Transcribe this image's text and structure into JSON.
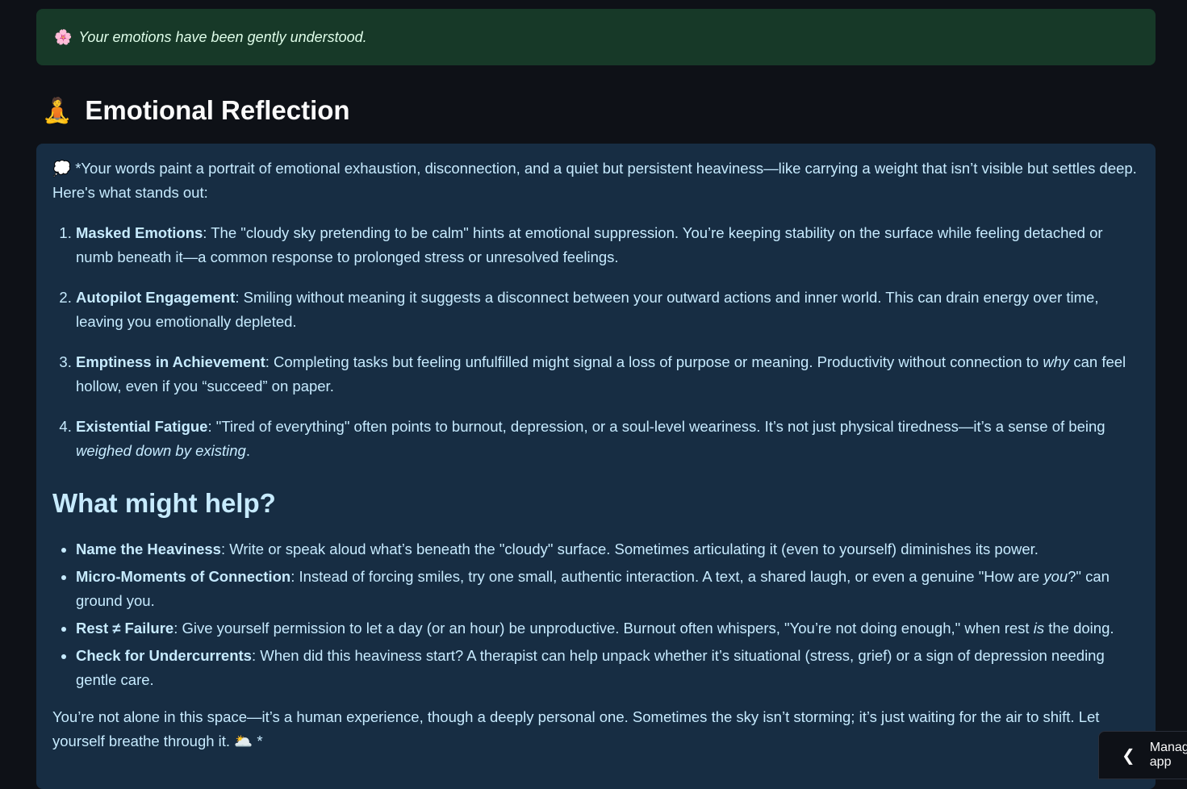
{
  "success": {
    "icon": "flower-emoji",
    "flower_glyph": "🌸",
    "text": "Your emotions have been gently understood."
  },
  "section": {
    "icon": "meditation-emoji",
    "emoji": "🧘",
    "title": "Emotional Reflection"
  },
  "reflection": {
    "intro_icon": "💭",
    "intro": "*Your words paint a portrait of emotional exhaustion, disconnection, and a quiet but persistent heaviness—like carrying a weight that isn’t visible but settles deep. Here's what stands out:",
    "points": [
      {
        "title": "Masked Emotions",
        "text": ": The \"cloudy sky pretending to be calm\" hints at emotional suppression. You’re keeping stability on the surface while feeling detached or numb beneath it—a common response to prolonged stress or unresolved feelings."
      },
      {
        "title": "Autopilot Engagement",
        "text": ": Smiling without meaning it suggests a disconnect between your outward actions and inner world. This can drain energy over time, leaving you emotionally depleted."
      },
      {
        "title": "Emptiness in Achievement",
        "text_before": ": Completing tasks but feeling unfulfilled might signal a loss of purpose or meaning. Productivity without connection to ",
        "em": "why",
        "text_after": " can feel hollow, even if you “succeed” on paper."
      },
      {
        "title": "Existential Fatigue",
        "text_before": ": \"Tired of everything\" often points to burnout, depression, or a soul-level weariness. It’s not just physical tiredness—it’s a sense of being ",
        "em": "weighed down by existing",
        "text_after": "."
      }
    ],
    "help_heading": "What might help?",
    "help": [
      {
        "title": "Name the Heaviness",
        "text": ": Write or speak aloud what’s beneath the \"cloudy\" surface. Sometimes articulating it (even to yourself) diminishes its power."
      },
      {
        "title": "Micro-Moments of Connection",
        "text_before": ": Instead of forcing smiles, try one small, authentic interaction. A text, a shared laugh, or even a genuine \"How are ",
        "em": "you",
        "text_after": "?\" can ground you."
      },
      {
        "title": "Rest ≠ Failure",
        "text_before": ": Give yourself permission to let a day (or an hour) be unproductive. Burnout often whispers, \"You’re not doing enough,\" when rest ",
        "em": "is",
        "text_after": " the doing."
      },
      {
        "title": "Check for Undercurrents",
        "text": ": When did this heaviness start? A therapist can help unpack whether it’s situational (stress, grief) or a sign of depression needing gentle care."
      }
    ],
    "closing": "You’re not alone in this space—it’s a human experience, though a deeply personal one. Sometimes the sky isn’t storming; it’s just waiting for the air to shift. Let yourself breathe through it. ",
    "closing_icon": "🌥️",
    "closing_end": " *"
  },
  "manage": {
    "label": "Manage app",
    "icon": "chevron-left-icon"
  }
}
